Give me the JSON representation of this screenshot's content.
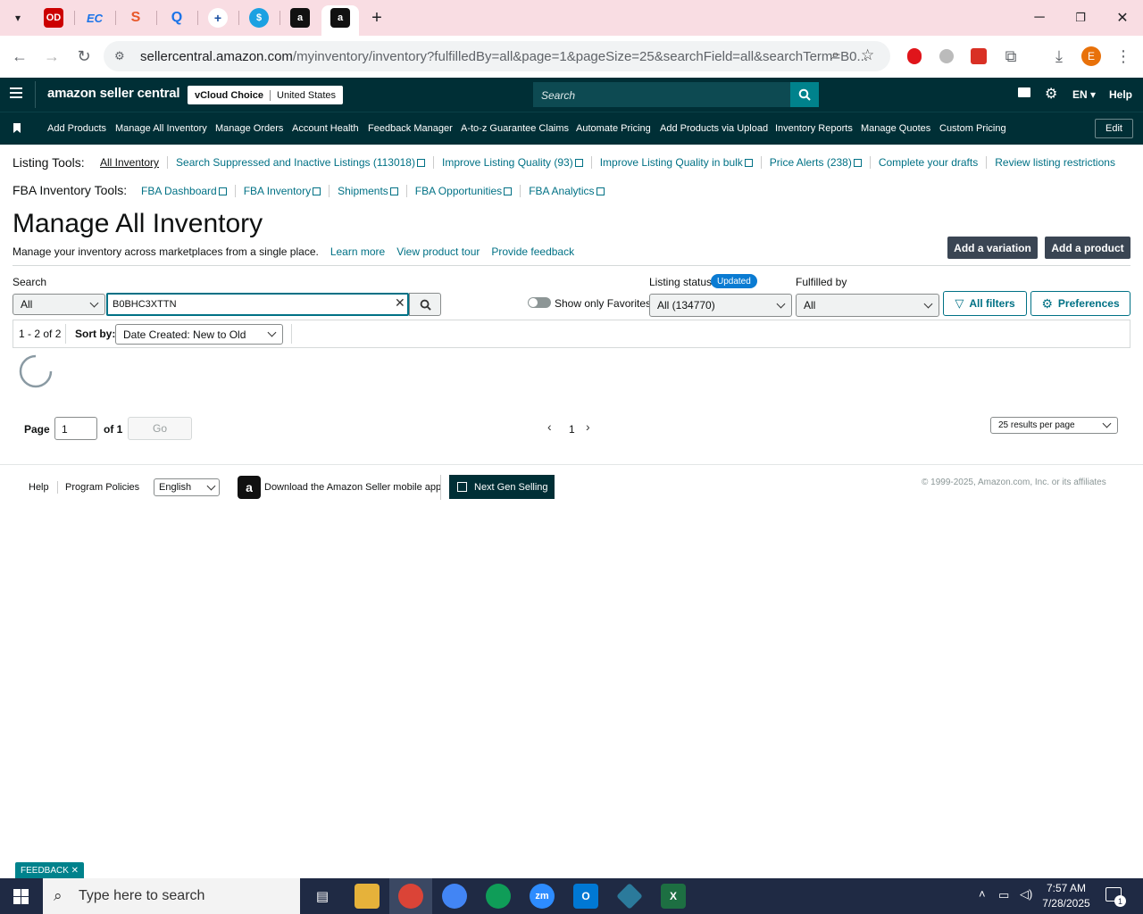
{
  "browser": {
    "tabs": [
      {
        "icon": "office-depot-icon",
        "label": "OD"
      },
      {
        "icon": "ec-icon",
        "label": "EC"
      },
      {
        "icon": "swirl-icon",
        "label": "S"
      },
      {
        "icon": "quote-icon",
        "label": "Q"
      },
      {
        "icon": "plus-circle-icon",
        "label": "+"
      },
      {
        "icon": "dollar-icon",
        "label": "$"
      },
      {
        "icon": "amazon-icon",
        "label": "a"
      },
      {
        "icon": "amazon-icon",
        "label": "a"
      }
    ],
    "new_tab": "+",
    "url_host": "sellercentral.amazon.com",
    "url_path": "/myinventory/inventory?fulfilledBy=all&page=1&pageSize=25&searchField=all&searchTerm=B0...",
    "profile_initial": "E"
  },
  "header": {
    "logo": "amazon seller central",
    "store": "vCloud Choice",
    "region": "United States",
    "search_placeholder": "Search",
    "lang": "EN",
    "help": "Help"
  },
  "nav": {
    "items": [
      "Add Products",
      "Manage All Inventory",
      "Manage Orders",
      "Account Health",
      "Feedback Manager",
      "A-to-z Guarantee Claims",
      "Automate Pricing",
      "Add Products via Upload",
      "Inventory Reports",
      "Manage Quotes",
      "Custom Pricing"
    ],
    "edit": "Edit"
  },
  "listing_tools": {
    "label": "Listing Tools:",
    "links": [
      "All Inventory",
      "Search Suppressed and Inactive Listings (113018)",
      "Improve Listing Quality (93)",
      "Improve Listing Quality in bulk",
      "Price Alerts (238)",
      "Complete your drafts",
      "Review listing restrictions"
    ]
  },
  "fba_tools": {
    "label": "FBA Inventory Tools:",
    "links": [
      "FBA Dashboard",
      "FBA Inventory",
      "Shipments",
      "FBA Opportunities",
      "FBA Analytics"
    ]
  },
  "page": {
    "title": "Manage All Inventory",
    "subtitle": "Manage your inventory across marketplaces from a single place.",
    "learn_more": "Learn more",
    "tour": "View product tour",
    "feedback": "Provide feedback",
    "add_variation": "Add a variation",
    "add_product": "Add a product"
  },
  "filters": {
    "search_label": "Search",
    "search_scope": "All",
    "search_value": "B0BHC3XTTN",
    "favorites": "Show only Favorites",
    "listing_status_label": "Listing status",
    "updated_badge": "Updated",
    "listing_status_value": "All (134770)",
    "fulfilled_label": "Fulfilled by",
    "fulfilled_value": "All",
    "all_filters": "All filters",
    "preferences": "Preferences"
  },
  "results": {
    "count": "1 - 2 of 2",
    "sort_label": "Sort by:",
    "sort_value": "Date Created: New to Old"
  },
  "pagination": {
    "page_label": "Page",
    "page_value": "1",
    "of": "of 1",
    "go": "Go",
    "current": "1",
    "per_page": "25 results per page"
  },
  "footer": {
    "help": "Help",
    "policies": "Program Policies",
    "language": "English",
    "app": "Download the Amazon Seller mobile app",
    "next_gen": "Next Gen Selling",
    "copyright": "© 1999-2025, Amazon.com, Inc. or its affiliates",
    "feedback_tab": "FEEDBACK"
  },
  "taskbar": {
    "search_placeholder": "Type here to search",
    "time": "7:57 AM",
    "date": "7/28/2025",
    "notification_count": "1"
  },
  "colors": {
    "header_bg": "#002f36",
    "link": "#007185",
    "tab_strip": "#f9dde3"
  }
}
